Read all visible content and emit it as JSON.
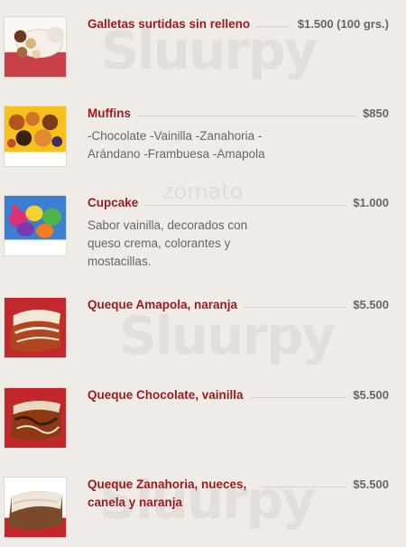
{
  "watermarks": [
    "Sluurpy",
    "zomato",
    "Sluurpy",
    "Sluurpy"
  ],
  "items": [
    {
      "name": "Galletas surtidas sin relleno",
      "price": "$1.500 (100 grs.)",
      "desc": "",
      "image": "cookies-plate-image"
    },
    {
      "name": "Muffins",
      "price": "$850",
      "desc": "-Chocolate -Vainilla -Zanahoria -Arándano -Frambuesa -Amapola",
      "image": "muffins-image"
    },
    {
      "name": "Cupcake",
      "price": "$1.000",
      "desc": "Sabor vainilla, decorados con queso crema, colorantes y mostacillas.",
      "image": "cupcakes-image"
    },
    {
      "name": "Queque Amapola, naranja",
      "price": "$5.500",
      "desc": "",
      "image": "poppy-cake-image"
    },
    {
      "name": "Queque Chocolate, vainilla",
      "price": "$5.500",
      "desc": "",
      "image": "chocolate-cake-image"
    },
    {
      "name": "Queque Zanahoria, nueces, canela y naranja",
      "price": "$5.500",
      "desc": "",
      "image": "carrot-cake-image"
    }
  ]
}
